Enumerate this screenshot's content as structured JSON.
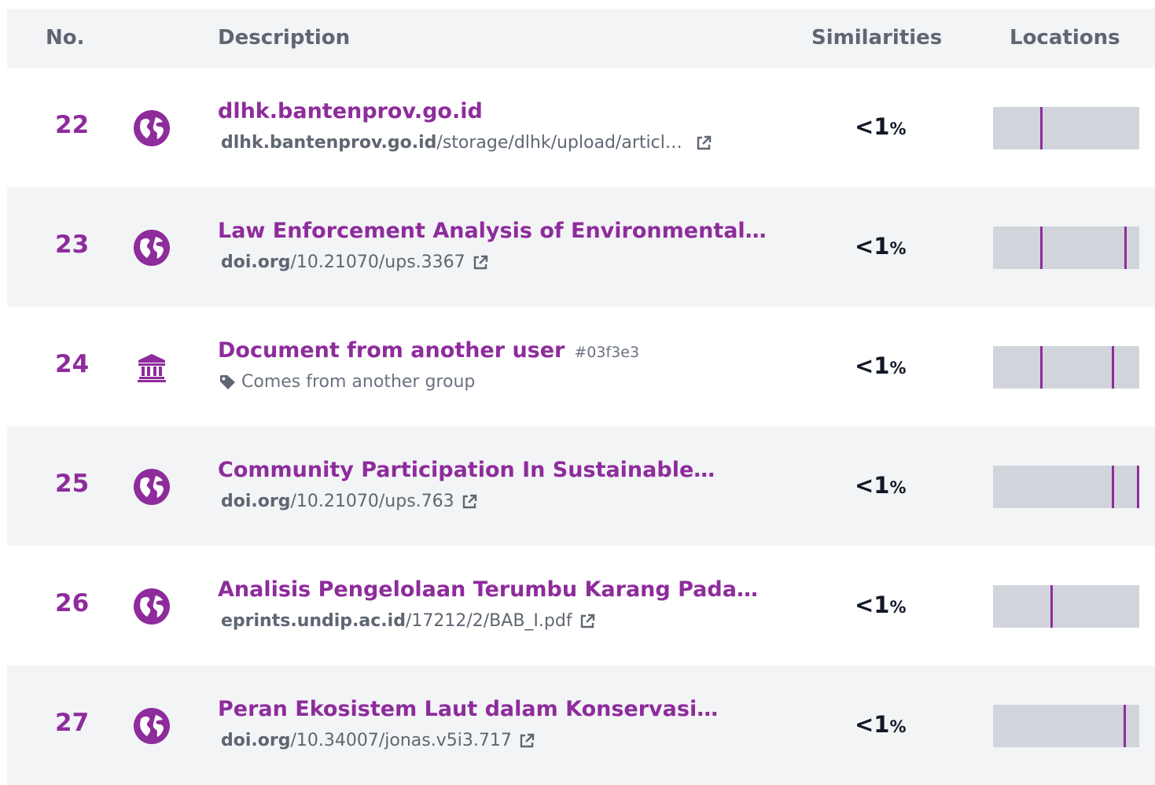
{
  "header": {
    "no": "No.",
    "description": "Description",
    "similarities": "Similarities",
    "locations": "Locations"
  },
  "colors": {
    "accent": "#8e2c9c",
    "row_alt": "#f3f4f6",
    "bar": "#d1d5db"
  },
  "rows": [
    {
      "num": "22",
      "icon": "globe-icon",
      "title": "dlhk.bantenprov.go.id",
      "domain": "dlhk.bantenprov.go.id",
      "path": "/storage/dlhk/upload/articl…",
      "similarity": "<1",
      "pct": "%",
      "marks": [
        0.32
      ]
    },
    {
      "num": "23",
      "icon": "globe-icon",
      "title": "Law Enforcement Analysis of Environmental…",
      "domain": "doi.org",
      "path": "/10.21070/ups.3367",
      "similarity": "<1",
      "pct": "%",
      "marks": [
        0.32,
        0.9
      ]
    },
    {
      "num": "24",
      "icon": "institution-icon",
      "title": "Document from another user",
      "hash": "#03f3e3",
      "group": "Comes from another group",
      "similarity": "<1",
      "pct": "%",
      "marks": [
        0.32,
        0.81
      ]
    },
    {
      "num": "25",
      "icon": "globe-icon",
      "title": "Community Participation In Sustainable…",
      "domain": "doi.org",
      "path": "/10.21070/ups.763",
      "similarity": "<1",
      "pct": "%",
      "marks": [
        0.81,
        0.99
      ]
    },
    {
      "num": "26",
      "icon": "globe-icon",
      "title": "Analisis Pengelolaan Terumbu Karang Pada…",
      "domain": "eprints.undip.ac.id",
      "path": "/17212/2/BAB_I.pdf",
      "similarity": "<1",
      "pct": "%",
      "marks": [
        0.39
      ]
    },
    {
      "num": "27",
      "icon": "globe-icon",
      "title": "Peran Ekosistem Laut dalam Konservasi…",
      "domain": "doi.org",
      "path": "/10.34007/jonas.v5i3.717",
      "similarity": "<1",
      "pct": "%",
      "marks": [
        0.89
      ]
    }
  ]
}
